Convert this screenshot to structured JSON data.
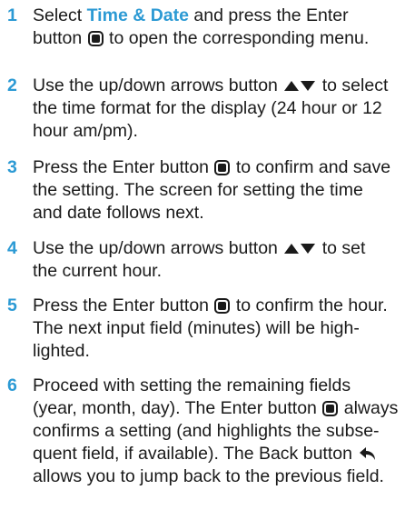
{
  "colors": {
    "accent": "#2c9ad4",
    "text": "#1a1a1a"
  },
  "icons": {
    "enter": "enter-button-icon",
    "arrows": "up-down-arrows-icon",
    "back": "back-arrow-icon"
  },
  "steps": [
    {
      "number": "1",
      "lines": [
        "Select ",
        " and press the Enter",
        "button ",
        " to open the corresponding menu."
      ],
      "highlight": "Time & Date"
    },
    {
      "number": "2",
      "lines": [
        "Use the up/down arrows button ",
        " to select",
        "the time format for the display (24 hour or 12",
        "hour am/pm)."
      ]
    },
    {
      "number": "3",
      "lines": [
        "Press the Enter button ",
        " to confirm and save",
        "the setting. The screen for setting the time",
        "and date follows next."
      ]
    },
    {
      "number": "4",
      "lines": [
        "Use the up/down arrows button ",
        " to set",
        "the current hour."
      ]
    },
    {
      "number": "5",
      "lines": [
        "Press the Enter button ",
        " to confirm the hour.",
        "The next input field (minutes) will be high-",
        "lighted."
      ]
    },
    {
      "number": "6",
      "lines": [
        "Proceed with setting the remaining fields",
        "(year, month, day). The Enter button ",
        " always",
        "confirms a setting (and highlights the subse-",
        "quent field, if available). The Back button ",
        "allows you to jump back to the previous field."
      ]
    }
  ]
}
